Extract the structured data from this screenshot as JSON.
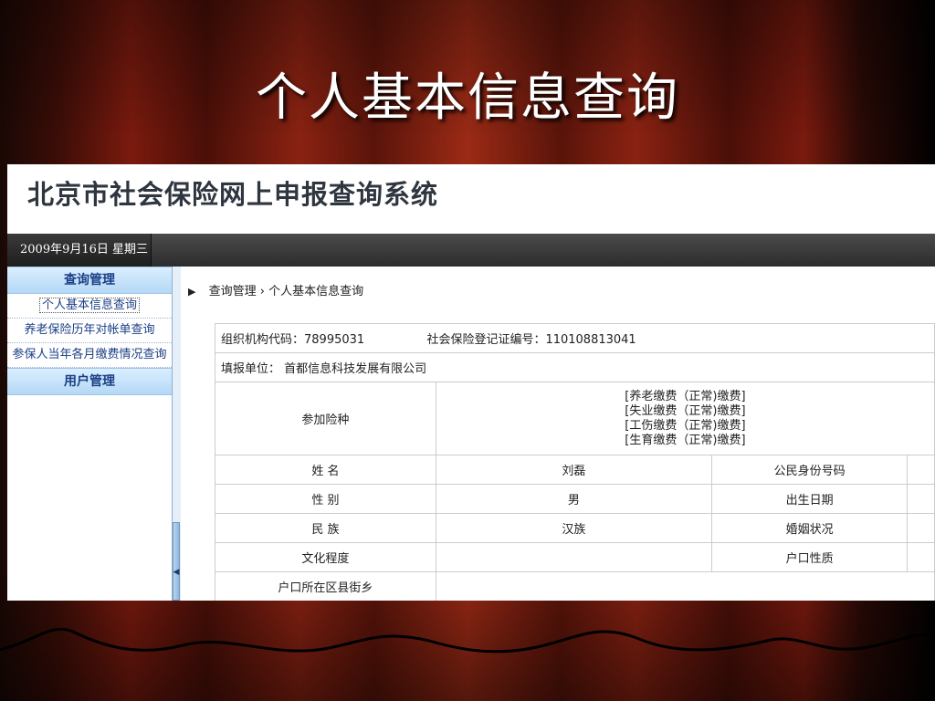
{
  "slide": {
    "title": "个人基本信息查询"
  },
  "system": {
    "title": "北京市社会保险网上申报查询系统",
    "date": "2009年9月16日 星期三"
  },
  "sidebar": {
    "sections": [
      {
        "label": "查询管理",
        "items": [
          {
            "label": "个人基本信息查询"
          },
          {
            "label": "养老保险历年对帐单查询"
          },
          {
            "label": "参保人当年各月缴费情况查询"
          }
        ]
      },
      {
        "label": "用户管理"
      }
    ]
  },
  "breadcrumb": {
    "parent": "查询管理",
    "separator": "›",
    "current": "个人基本信息查询"
  },
  "info": {
    "org_code": "组织机构代码：78995031",
    "reg_no": "社会保险登记证编号：110108813041",
    "unit": "填报单位：  首都信息科技发展有限公司",
    "insurance_label": "参加险种",
    "insurance_types": [
      "[养老缴费（正常)缴费]",
      "[失业缴费（正常)缴费]",
      "[工伤缴费（正常)缴费]",
      "[生育缴费（正常)缴费]"
    ],
    "name_label": "姓 名",
    "name_value": "刘磊",
    "id_label": "公民身份号码",
    "gender_label": "性 别",
    "gender_value": "男",
    "birth_label": "出生日期",
    "ethnic_label": "民 族",
    "ethnic_value": "汉族",
    "marital_label": "婚姻状况",
    "education_label": "文化程度",
    "education_value": "",
    "hukou_type_label": "户口性质",
    "hukou_district_label": "户口所在区县街乡"
  }
}
